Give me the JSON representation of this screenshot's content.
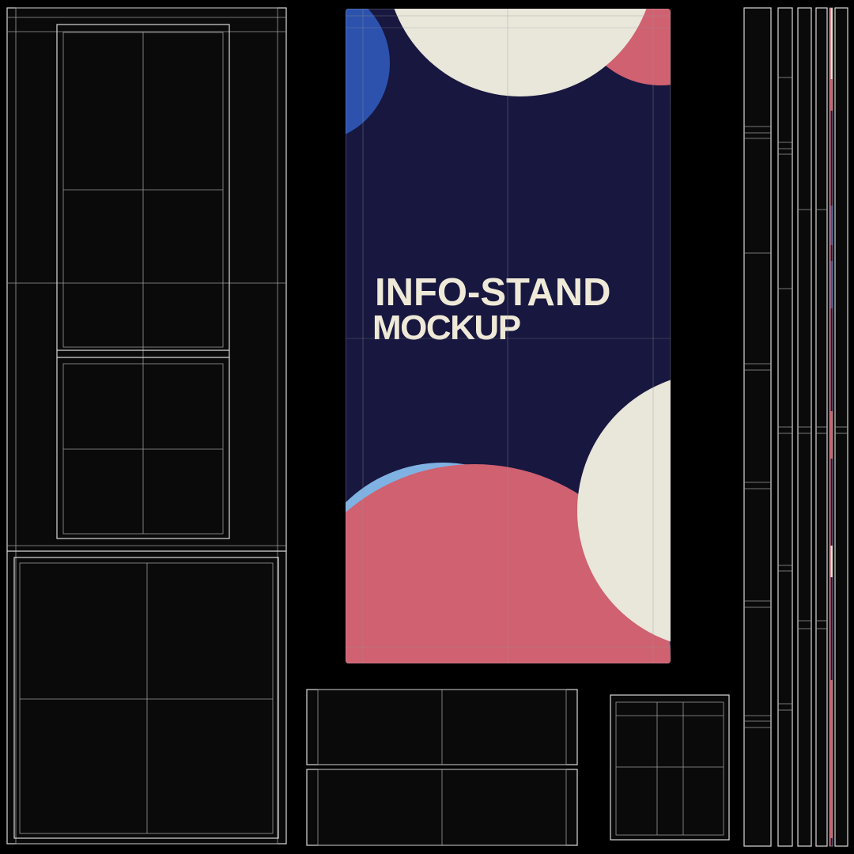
{
  "poster": {
    "title_line1": "INFO-STAND",
    "title_line2": "MOCKUP"
  },
  "colors": {
    "background": "#000000",
    "wireframe": "#d8d8d8",
    "poster_navy": "#17173f",
    "poster_cream": "#e9e6da",
    "poster_pink": "#cf6170",
    "poster_blue": "#2c52ad",
    "poster_light_blue": "#7fb2e3",
    "title_text": "#efe9d8"
  }
}
